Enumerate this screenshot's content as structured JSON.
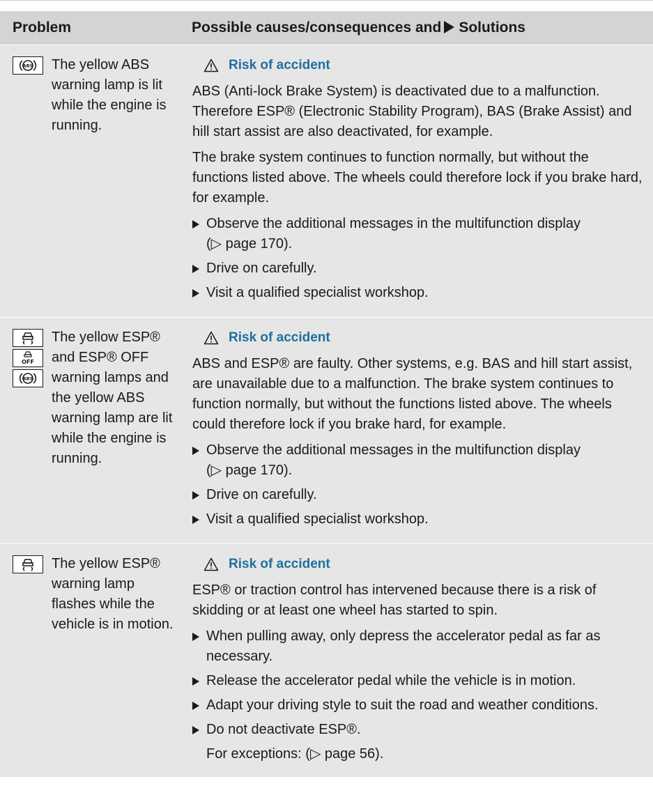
{
  "header": {
    "problem": "Problem",
    "solutions_prefix": "Possible causes/consequences and",
    "solutions_suffix": "Solutions"
  },
  "rows": [
    {
      "icons": [
        "abs-warning-icon"
      ],
      "problem": "The yellow ABS warning lamp is lit while the engine is running.",
      "warning_title": "Risk of accident",
      "paragraphs": [
        "ABS (Anti-lock Brake System) is deactivated due to a malfunction. Therefore ESP® (Electronic Stability Program), BAS (Brake Assist) and hill start assist are also deactivated, for example.",
        "The brake system continues to function normally, but without the functions listed above. The wheels could therefore lock if you brake hard, for example."
      ],
      "steps": [
        {
          "text": "Observe the additional messages in the multifunction display",
          "ref": "(▷ page 170)."
        },
        {
          "text": "Drive on carefully."
        },
        {
          "text": "Visit a qualified specialist workshop."
        }
      ]
    },
    {
      "icons": [
        "esp-warning-icon",
        "esp-off-warning-icon",
        "abs-warning-icon"
      ],
      "problem": "The yellow ESP® and ESP® OFF warning lamps and the yellow ABS warning lamp are lit while the engine is running.",
      "warning_title": "Risk of accident",
      "paragraphs": [
        "ABS and ESP® are faulty. Other systems, e.g. BAS and hill start assist, are unavailable due to a malfunction. The brake system continues to function normally, but without the functions listed above. The wheels could therefore lock if you brake hard, for example."
      ],
      "steps": [
        {
          "text": "Observe the additional messages in the multifunction display",
          "ref": "(▷ page 170)."
        },
        {
          "text": "Drive on carefully."
        },
        {
          "text": "Visit a qualified specialist workshop."
        }
      ]
    },
    {
      "icons": [
        "esp-warning-icon"
      ],
      "problem": "The yellow ESP® warning lamp flashes while the vehicle is in motion.",
      "warning_title": "Risk of accident",
      "paragraphs": [
        "ESP® or traction control has intervened because there is a risk of skidding or at least one wheel has started to spin."
      ],
      "steps": [
        {
          "text": "When pulling away, only depress the accelerator pedal as far as necessary."
        },
        {
          "text": "Release the accelerator pedal while the vehicle is in motion."
        },
        {
          "text": "Adapt your driving style to suit the road and weather conditions."
        },
        {
          "text": "Do not deactivate ESP®.",
          "ref": "For exceptions: (▷ page 56)."
        }
      ]
    }
  ],
  "colors": {
    "header_bg": "#d4d4d4",
    "row_bg": "#e6e6e6",
    "warning_title": "#1f6f9e"
  }
}
